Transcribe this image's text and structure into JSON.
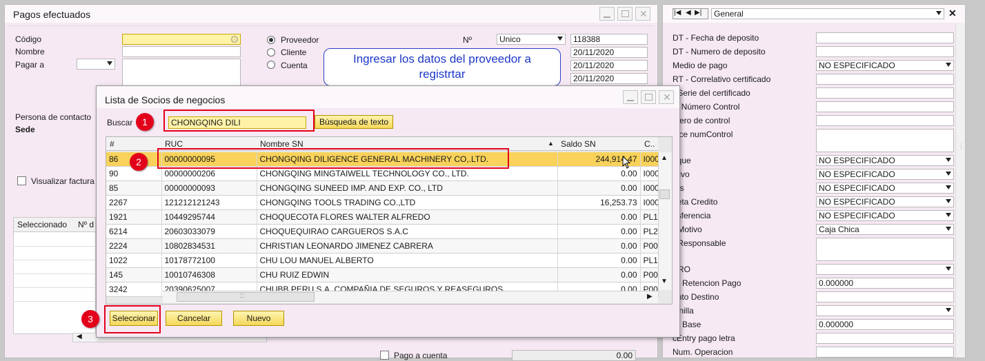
{
  "main_window": {
    "title": "Pagos efectuados",
    "labels": {
      "codigo": "Código",
      "nombre": "Nombre",
      "pagar_a": "Pagar a",
      "persona_contacto": "Persona de contacto",
      "sede": "Sede",
      "visualizar_facturas": "Visualizar factura"
    },
    "radios": [
      {
        "label": "Proveedor",
        "selected": true
      },
      {
        "label": "Cliente",
        "selected": false
      },
      {
        "label": "Cuenta",
        "selected": false
      }
    ],
    "n_label": "Nº",
    "n_series": "Unico",
    "n_value": "118388",
    "dates": [
      "20/11/2020",
      "20/11/2020",
      "20/11/2020"
    ],
    "grid_headers": [
      "Seleccionado",
      "Nº d"
    ],
    "pago_a_cuenta_label": "Pago a cuenta",
    "pago_a_cuenta_value": "0.00"
  },
  "callout": {
    "text_line1": "Ingresar los datos del proveedor a",
    "text_line2": "registrtar"
  },
  "dialog": {
    "title": "Lista de Socios de negocios",
    "buscar_label": "Buscar",
    "buscar_value": "CHONGQING DILI",
    "busqueda_texto_button": "Búsqueda de texto",
    "columns": [
      "#",
      "RUC",
      "Nombre SN",
      "Saldo SN",
      "C.."
    ],
    "rows": [
      {
        "n": "86",
        "ruc": "00000000095",
        "nombre": "CHONGQING DILIGENCE GENERAL MACHINERY CO,.LTD.",
        "saldo": "244,914.47",
        "c": "I000"
      },
      {
        "n": "90",
        "ruc": "00000000206",
        "nombre": "CHONGQING MINGTAIWELL TECHNOLOGY CO., LTD.",
        "saldo": "0.00",
        "c": "I000"
      },
      {
        "n": "85",
        "ruc": "00000000093",
        "nombre": "CHONGQING SUNEED IMP. AND EXP. CO., LTD",
        "saldo": "0.00",
        "c": "I000"
      },
      {
        "n": "2267",
        "ruc": "121212121243",
        "nombre": "CHONGQING TOOLS TRADING CO.,LTD",
        "saldo": "16,253.73",
        "c": "I000"
      },
      {
        "n": "1921",
        "ruc": "10449295744",
        "nombre": "CHOQUECOTA FLORES WALTER ALFREDO",
        "saldo": "0.00",
        "c": "PL10"
      },
      {
        "n": "6214",
        "ruc": "20603033079",
        "nombre": "CHOQUEQUIRAO CARGUEROS S.A.C",
        "saldo": "0.00",
        "c": "PL20"
      },
      {
        "n": "2224",
        "ruc": "10802834531",
        "nombre": "CHRISTIAN LEONARDO JIMENEZ CABRERA",
        "saldo": "0.00",
        "c": "P000"
      },
      {
        "n": "1022",
        "ruc": "10178772100",
        "nombre": "CHU LOU MANUEL ALBERTO",
        "saldo": "0.00",
        "c": "PL10"
      },
      {
        "n": "145",
        "ruc": "10010746308",
        "nombre": "CHU RUIZ EDWIN",
        "saldo": "0.00",
        "c": "P001"
      },
      {
        "n": "3242",
        "ruc": "20390625007",
        "nombre": "CHUBB PERU S.A. COMPAÑIA DE SEGUROS Y REASEGUROS",
        "saldo": "0.00",
        "c": "P000"
      }
    ],
    "buttons": {
      "seleccionar": "Seleccionar",
      "cancelar": "Cancelar",
      "nuevo": "Nuevo"
    },
    "grip": ":::"
  },
  "badges": [
    "1",
    "2",
    "3"
  ],
  "right_panel": {
    "tab_label": "General",
    "nav_glyphs": {
      "first": "|◀",
      "prev": "◀",
      "next": "▶|",
      "close": "✕"
    },
    "fields": [
      {
        "label": "DT - Fecha de deposito",
        "value": "",
        "dropdown": false
      },
      {
        "label": "DT - Numero de deposito",
        "value": "",
        "dropdown": false
      },
      {
        "label": "Medio de pago",
        "value": "NO ESPECIFICADO",
        "dropdown": true
      },
      {
        "label": "RT - Correlativo certificado",
        "value": "",
        "dropdown": false
      },
      {
        "label": "- Serie del certificado",
        "value": "",
        "dropdown": false
      },
      {
        "label": "ie Número Control",
        "value": "",
        "dropdown": false
      },
      {
        "label": "mero de control",
        "value": "",
        "dropdown": false
      },
      {
        "label": "lace numControl",
        "value": "",
        "dropdown": false,
        "tall": true
      },
      {
        "label": "eque",
        "value": "NO ESPECIFICADO",
        "dropdown": true
      },
      {
        "label": "ctivo",
        "value": "NO ESPECIFICADO",
        "dropdown": true
      },
      {
        "label": "ras",
        "value": "NO ESPECIFICADO",
        "dropdown": true
      },
      {
        "label": "rjeta Credito",
        "value": "NO ESPECIFICADO",
        "dropdown": true
      },
      {
        "label": "nsferencia",
        "value": "NO ESPECIFICADO",
        "dropdown": true
      },
      {
        "label": "- Motivo",
        "value": "Caja Chica",
        "dropdown": true
      },
      {
        "label": "- Responsable",
        "value": "",
        "dropdown": false,
        "tall": true
      },
      {
        "label": "BRO",
        "value": "",
        "dropdown": true
      },
      {
        "label": "or Retencion Pago",
        "value": "0.000000",
        "dropdown": false
      },
      {
        "label": "ento Destino",
        "value": "",
        "dropdown": false
      },
      {
        "label": "lanilla",
        "value": "",
        "dropdown": true
      },
      {
        "label": "or Base",
        "value": "0.000000",
        "dropdown": false
      },
      {
        "label": "cEntry pago letra",
        "value": "",
        "dropdown": false
      },
      {
        "label": "Num. Operacion",
        "value": "",
        "dropdown": false
      }
    ]
  },
  "colors": {
    "form_bg": "#f6e9f3",
    "accent_red": "#e3001b",
    "selected_row": "#f8d25a",
    "callout_border": "#2c3ec6",
    "callout_text": "#1c37c8"
  }
}
